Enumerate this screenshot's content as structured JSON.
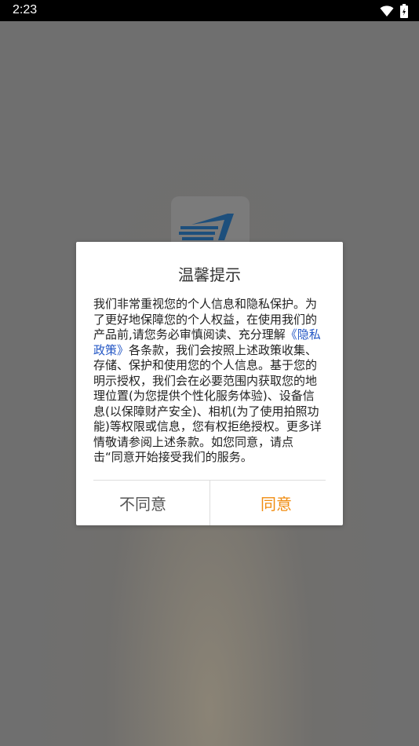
{
  "status_bar": {
    "time": "2:23",
    "icons": [
      "wifi-icon",
      "battery-icon"
    ]
  },
  "dialog": {
    "title": "温馨提示",
    "body_before_link": "我们非常重视您的个人信息和隐私保护。为了更好地保障您的个人权益，在使用我们的产品前,请您务必审慎阅读、充分理解",
    "link_text": "《隐私政策》",
    "body_after_link": "各条款，我们会按照上述政策收集、存储、保护和使用您的个人信息。基于您的明示授权，我们会在必要范围内获取您的地理位置(为您提供个性化服务体验)、设备信息(以保障财产安全)、相机(为了使用拍照功能)等权限或信息，您有权拒绝授权。更多详情敬请参阅上述条款。如您同意，请点击“同意开始接受我们的服务。",
    "disagree_label": "不同意",
    "agree_label": "同意"
  },
  "colors": {
    "link": "#2457c5",
    "agree": "#f08c10",
    "overlay": "#6f6f6f"
  }
}
